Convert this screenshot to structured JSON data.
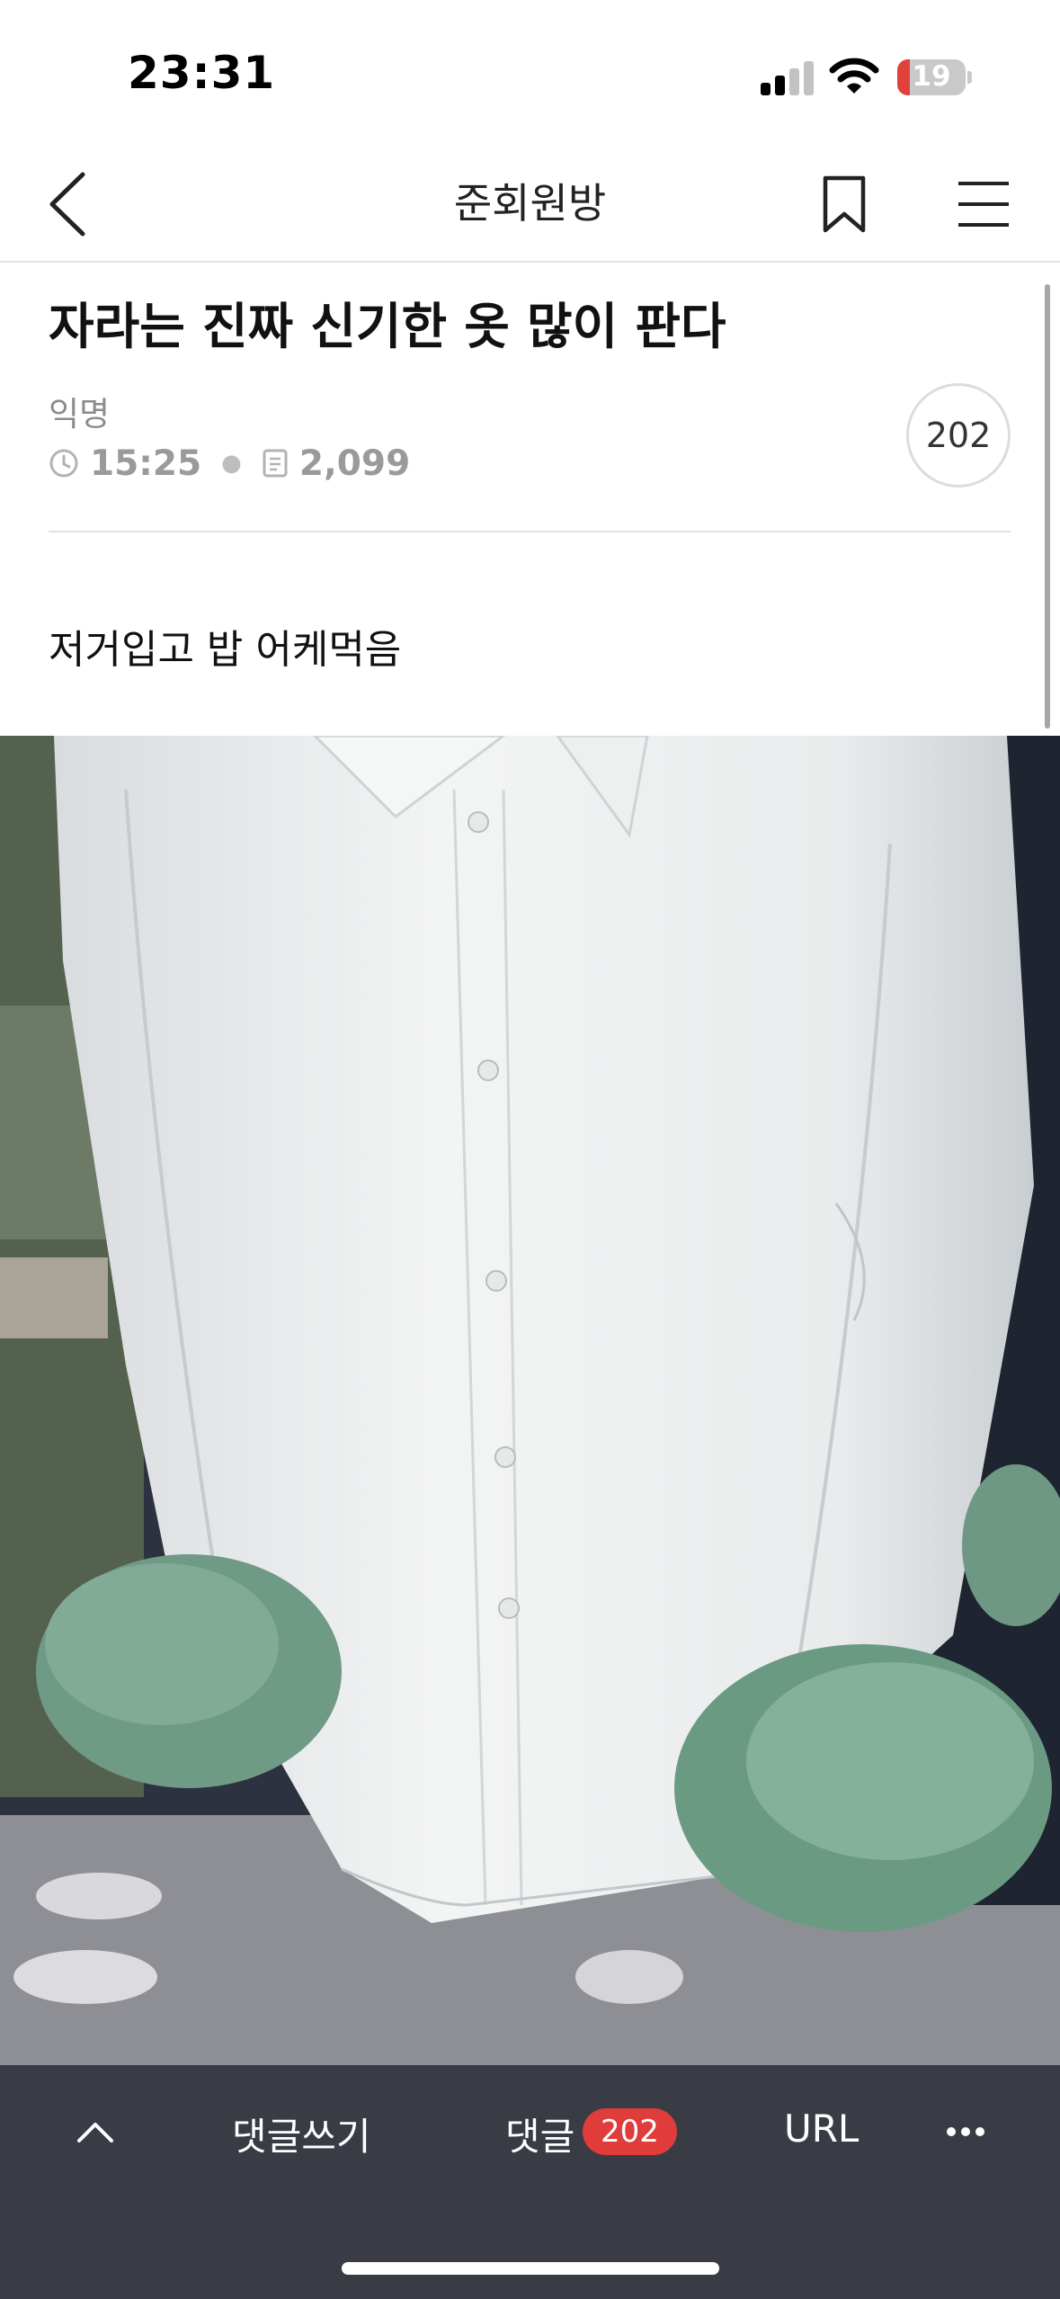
{
  "status_bar": {
    "time": "23:31",
    "battery_level": "19",
    "battery_color": "#e0413b"
  },
  "nav": {
    "title": "준회원방",
    "back_icon": "chevron-left-icon",
    "bookmark_icon": "bookmark-icon",
    "menu_icon": "hamburger-menu-icon"
  },
  "post": {
    "title": "자라는 진짜 신기한 옷 많이 판다",
    "author": "익명",
    "time": "15:25",
    "views": "2,099",
    "comment_count": "202",
    "body": "저거입고 밥 어케먹음"
  },
  "bottom_bar": {
    "write_comment": "댓글쓰기",
    "comments_label": "댓글",
    "comments_badge": "202",
    "url_label": "URL",
    "badge_color": "#e03c3c"
  }
}
